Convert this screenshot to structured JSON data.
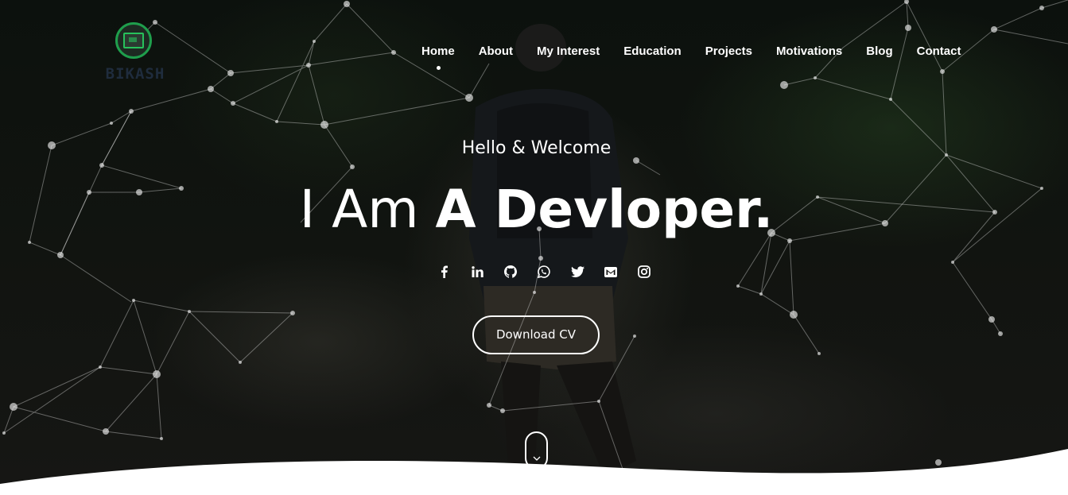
{
  "brand": {
    "logo_text": "BIKASH",
    "logo_icon": "chip-icon"
  },
  "nav": {
    "items": [
      {
        "label": "Home"
      },
      {
        "label": "About"
      },
      {
        "label": "My Interest"
      },
      {
        "label": "Education"
      },
      {
        "label": "Projects"
      },
      {
        "label": "Motivations"
      },
      {
        "label": "Blog"
      },
      {
        "label": "Contact"
      }
    ],
    "active": "Home"
  },
  "hero": {
    "welcome": "Hello & Welcome",
    "headline_light": "I Am ",
    "headline_bold": "A Devloper.",
    "cv_button": "Download CV"
  },
  "social_icons": [
    "facebook-icon",
    "linkedin-icon",
    "github-icon",
    "whatsapp-icon",
    "twitter-icon",
    "mail-icon",
    "instagram-icon"
  ],
  "scroll_icon": "chevron-down-icon",
  "colors": {
    "brand_green": "#1f9e4c",
    "text": "#ffffff",
    "wave": "#ffffff"
  }
}
